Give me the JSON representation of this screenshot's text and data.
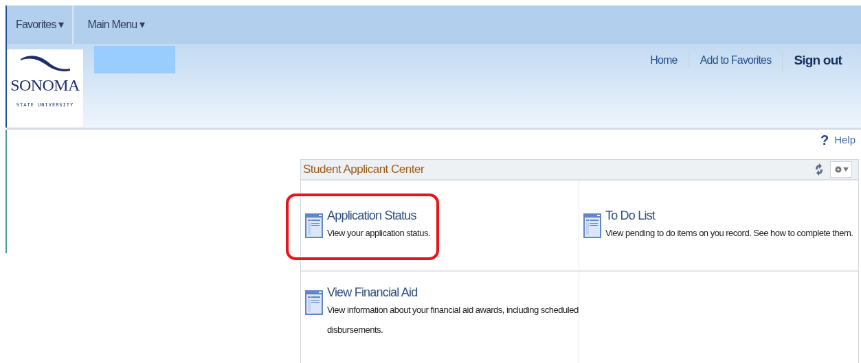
{
  "nav_menus": [
    {
      "label": "Favorites",
      "caret": "▾"
    },
    {
      "label": "Main Menu",
      "caret": "▾"
    }
  ],
  "logo": {
    "name": "SONOMA",
    "subtitle": "STATE UNIVERSITY"
  },
  "header_links": [
    {
      "label": "Home",
      "kind": "link"
    },
    {
      "label": "Add to Favorites",
      "kind": "link"
    },
    {
      "label": "Sign out",
      "kind": "strong"
    }
  ],
  "help": {
    "mark": "?",
    "label": "Help"
  },
  "panel": {
    "title": "Student Applicant Center",
    "tiles": [
      {
        "title": "Application Status",
        "description": "View your application status.",
        "highlighted": true
      },
      {
        "title": "To Do List",
        "description": "View pending to do items on you record. See how to complete them.",
        "highlighted": false
      },
      {
        "title": "View Financial Aid",
        "description": "View information about your financial aid awards, including scheduled disbursements.",
        "highlighted": false
      }
    ]
  }
}
